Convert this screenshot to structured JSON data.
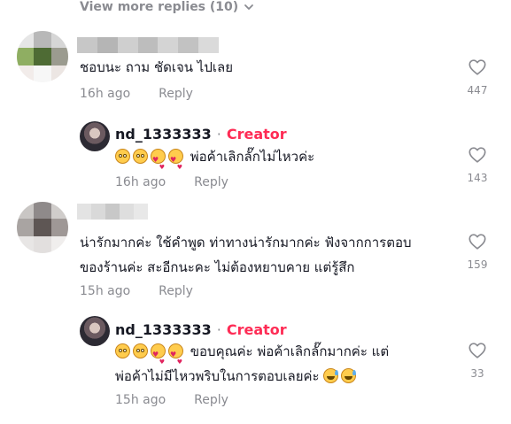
{
  "view_more": {
    "label": "View more replies (10)"
  },
  "comments": [
    {
      "text_lines": [
        "ชอบนะ ถาม ชัดเจน ไปเลย"
      ],
      "time": "16h ago",
      "reply_label": "Reply",
      "likes": "447",
      "avatar_colors": [
        "#e6e6e6",
        "#b8b8b8",
        "#d6d6d6",
        "#8fae62",
        "#4e6b34",
        "#9b9b8f",
        "#f2ecea",
        "#f7f7f7",
        "#ece6e3"
      ],
      "name_blur": [
        "#c7c7c7",
        "#b5b5b5",
        "#cfcfcf",
        "#bdbdbd",
        "#d4d4d4",
        "#c2c2c2",
        "#dadada"
      ]
    },
    {
      "text_lines": [
        "น่ารักมากค่ะ ใช้คำพูด ท่าทางน่ารักมากค่ะ ฟังจากการตอบ",
        "ของร้านค่ะ สะอีกนะคะ ไม่ต้องหยาบคาย แต่รู้สึก"
      ],
      "time": "15h ago",
      "reply_label": "Reply",
      "likes": "159",
      "avatar_colors": [
        "#c9c6c4",
        "#8f8a8a",
        "#d0cdcb",
        "#a9a4a2",
        "#5e5654",
        "#9f9896",
        "#e8e6e5",
        "#e2dfde",
        "#f0eeed"
      ],
      "name_blur": [
        "#e3e3e3",
        "#d9d9d9",
        "#c8c8c8",
        "#dedede",
        "#e8e8e8"
      ]
    }
  ],
  "replies": [
    {
      "author": "nd_1333333",
      "separator": "·",
      "badge": "Creator",
      "emojis": [
        "flushed",
        "flushed",
        "hearts",
        "hearts"
      ],
      "text_lines": [
        "พ่อค้าเลิกลั๊กไม่ไหวค่ะ"
      ],
      "time": "16h ago",
      "reply_label": "Reply",
      "likes": "143"
    },
    {
      "author": "nd_1333333",
      "separator": "·",
      "badge": "Creator",
      "emojis": [
        "flushed",
        "flushed",
        "hearts",
        "hearts"
      ],
      "text_lines": [
        "ขอบคุณค่ะ พ่อค้าเลิกลั๊กมากค่ะ แต่",
        "พ่อค้าไม่มีไหวพริบในการตอบเลยค่ะ"
      ],
      "trailing_emojis": [
        "sweat",
        "sweat"
      ],
      "time": "15h ago",
      "reply_label": "Reply",
      "likes": "33"
    }
  ],
  "colors": {
    "creator_badge": "#fe2c55",
    "muted": "#8a8b91",
    "text": "#161823"
  },
  "icons": {
    "like": "heart-outline-icon",
    "expand": "chevron-down-icon"
  }
}
